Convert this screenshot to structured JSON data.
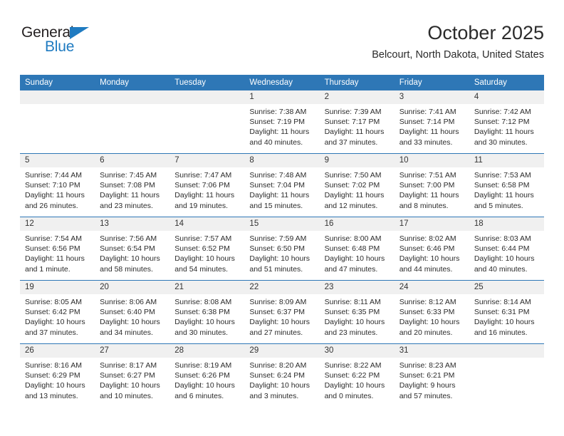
{
  "brand": {
    "name_top": "General",
    "name_bottom": "Blue",
    "triangle_color": "#1f7bc1",
    "text_color": "#231f20"
  },
  "header": {
    "month_title": "October 2025",
    "location": "Belcourt, North Dakota, United States"
  },
  "theme": {
    "header_blue": "#2e77b6",
    "daynum_band": "#f0f0f0",
    "text": "#2b2b2b"
  },
  "calendar": {
    "weekday_headers": [
      "Sunday",
      "Monday",
      "Tuesday",
      "Wednesday",
      "Thursday",
      "Friday",
      "Saturday"
    ],
    "weeks": [
      [
        {
          "day": "",
          "sunrise": "",
          "sunset": "",
          "daylight": ""
        },
        {
          "day": "",
          "sunrise": "",
          "sunset": "",
          "daylight": ""
        },
        {
          "day": "",
          "sunrise": "",
          "sunset": "",
          "daylight": ""
        },
        {
          "day": "1",
          "sunrise": "Sunrise: 7:38 AM",
          "sunset": "Sunset: 7:19 PM",
          "daylight": "Daylight: 11 hours and 40 minutes."
        },
        {
          "day": "2",
          "sunrise": "Sunrise: 7:39 AM",
          "sunset": "Sunset: 7:17 PM",
          "daylight": "Daylight: 11 hours and 37 minutes."
        },
        {
          "day": "3",
          "sunrise": "Sunrise: 7:41 AM",
          "sunset": "Sunset: 7:14 PM",
          "daylight": "Daylight: 11 hours and 33 minutes."
        },
        {
          "day": "4",
          "sunrise": "Sunrise: 7:42 AM",
          "sunset": "Sunset: 7:12 PM",
          "daylight": "Daylight: 11 hours and 30 minutes."
        }
      ],
      [
        {
          "day": "5",
          "sunrise": "Sunrise: 7:44 AM",
          "sunset": "Sunset: 7:10 PM",
          "daylight": "Daylight: 11 hours and 26 minutes."
        },
        {
          "day": "6",
          "sunrise": "Sunrise: 7:45 AM",
          "sunset": "Sunset: 7:08 PM",
          "daylight": "Daylight: 11 hours and 23 minutes."
        },
        {
          "day": "7",
          "sunrise": "Sunrise: 7:47 AM",
          "sunset": "Sunset: 7:06 PM",
          "daylight": "Daylight: 11 hours and 19 minutes."
        },
        {
          "day": "8",
          "sunrise": "Sunrise: 7:48 AM",
          "sunset": "Sunset: 7:04 PM",
          "daylight": "Daylight: 11 hours and 15 minutes."
        },
        {
          "day": "9",
          "sunrise": "Sunrise: 7:50 AM",
          "sunset": "Sunset: 7:02 PM",
          "daylight": "Daylight: 11 hours and 12 minutes."
        },
        {
          "day": "10",
          "sunrise": "Sunrise: 7:51 AM",
          "sunset": "Sunset: 7:00 PM",
          "daylight": "Daylight: 11 hours and 8 minutes."
        },
        {
          "day": "11",
          "sunrise": "Sunrise: 7:53 AM",
          "sunset": "Sunset: 6:58 PM",
          "daylight": "Daylight: 11 hours and 5 minutes."
        }
      ],
      [
        {
          "day": "12",
          "sunrise": "Sunrise: 7:54 AM",
          "sunset": "Sunset: 6:56 PM",
          "daylight": "Daylight: 11 hours and 1 minute."
        },
        {
          "day": "13",
          "sunrise": "Sunrise: 7:56 AM",
          "sunset": "Sunset: 6:54 PM",
          "daylight": "Daylight: 10 hours and 58 minutes."
        },
        {
          "day": "14",
          "sunrise": "Sunrise: 7:57 AM",
          "sunset": "Sunset: 6:52 PM",
          "daylight": "Daylight: 10 hours and 54 minutes."
        },
        {
          "day": "15",
          "sunrise": "Sunrise: 7:59 AM",
          "sunset": "Sunset: 6:50 PM",
          "daylight": "Daylight: 10 hours and 51 minutes."
        },
        {
          "day": "16",
          "sunrise": "Sunrise: 8:00 AM",
          "sunset": "Sunset: 6:48 PM",
          "daylight": "Daylight: 10 hours and 47 minutes."
        },
        {
          "day": "17",
          "sunrise": "Sunrise: 8:02 AM",
          "sunset": "Sunset: 6:46 PM",
          "daylight": "Daylight: 10 hours and 44 minutes."
        },
        {
          "day": "18",
          "sunrise": "Sunrise: 8:03 AM",
          "sunset": "Sunset: 6:44 PM",
          "daylight": "Daylight: 10 hours and 40 minutes."
        }
      ],
      [
        {
          "day": "19",
          "sunrise": "Sunrise: 8:05 AM",
          "sunset": "Sunset: 6:42 PM",
          "daylight": "Daylight: 10 hours and 37 minutes."
        },
        {
          "day": "20",
          "sunrise": "Sunrise: 8:06 AM",
          "sunset": "Sunset: 6:40 PM",
          "daylight": "Daylight: 10 hours and 34 minutes."
        },
        {
          "day": "21",
          "sunrise": "Sunrise: 8:08 AM",
          "sunset": "Sunset: 6:38 PM",
          "daylight": "Daylight: 10 hours and 30 minutes."
        },
        {
          "day": "22",
          "sunrise": "Sunrise: 8:09 AM",
          "sunset": "Sunset: 6:37 PM",
          "daylight": "Daylight: 10 hours and 27 minutes."
        },
        {
          "day": "23",
          "sunrise": "Sunrise: 8:11 AM",
          "sunset": "Sunset: 6:35 PM",
          "daylight": "Daylight: 10 hours and 23 minutes."
        },
        {
          "day": "24",
          "sunrise": "Sunrise: 8:12 AM",
          "sunset": "Sunset: 6:33 PM",
          "daylight": "Daylight: 10 hours and 20 minutes."
        },
        {
          "day": "25",
          "sunrise": "Sunrise: 8:14 AM",
          "sunset": "Sunset: 6:31 PM",
          "daylight": "Daylight: 10 hours and 16 minutes."
        }
      ],
      [
        {
          "day": "26",
          "sunrise": "Sunrise: 8:16 AM",
          "sunset": "Sunset: 6:29 PM",
          "daylight": "Daylight: 10 hours and 13 minutes."
        },
        {
          "day": "27",
          "sunrise": "Sunrise: 8:17 AM",
          "sunset": "Sunset: 6:27 PM",
          "daylight": "Daylight: 10 hours and 10 minutes."
        },
        {
          "day": "28",
          "sunrise": "Sunrise: 8:19 AM",
          "sunset": "Sunset: 6:26 PM",
          "daylight": "Daylight: 10 hours and 6 minutes."
        },
        {
          "day": "29",
          "sunrise": "Sunrise: 8:20 AM",
          "sunset": "Sunset: 6:24 PM",
          "daylight": "Daylight: 10 hours and 3 minutes."
        },
        {
          "day": "30",
          "sunrise": "Sunrise: 8:22 AM",
          "sunset": "Sunset: 6:22 PM",
          "daylight": "Daylight: 10 hours and 0 minutes."
        },
        {
          "day": "31",
          "sunrise": "Sunrise: 8:23 AM",
          "sunset": "Sunset: 6:21 PM",
          "daylight": "Daylight: 9 hours and 57 minutes."
        },
        {
          "day": "",
          "sunrise": "",
          "sunset": "",
          "daylight": ""
        }
      ]
    ]
  }
}
